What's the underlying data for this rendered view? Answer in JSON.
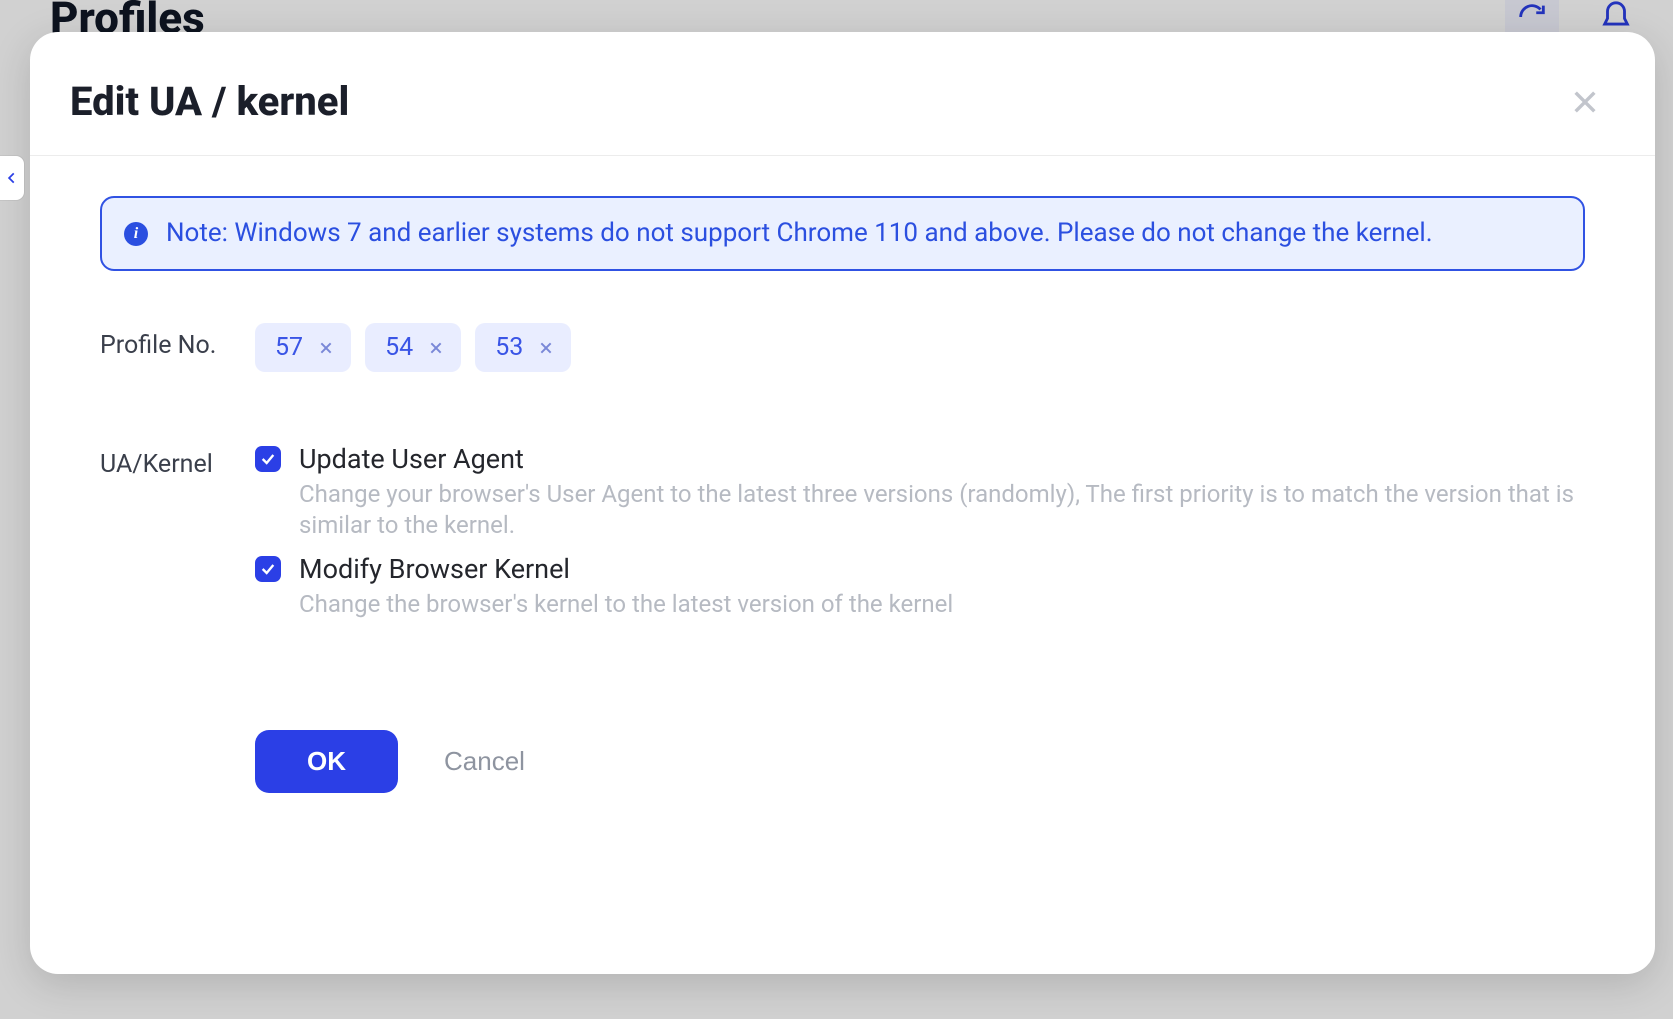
{
  "background": {
    "page_title": "Profiles"
  },
  "modal": {
    "title": "Edit UA / kernel",
    "alert": "Note: Windows 7 and earlier systems do not support Chrome 110 and above. Please do not change the kernel.",
    "profile_label": "Profile No.",
    "profile_tags": [
      "57",
      "54",
      "53"
    ],
    "ua_label": "UA/Kernel",
    "options": [
      {
        "title": "Update User Agent",
        "desc": "Change your browser's User Agent to the latest three versions (randomly), The first priority is to match the version that is similar to the kernel.",
        "checked": true
      },
      {
        "title": "Modify Browser Kernel",
        "desc": "Change the browser's kernel to the latest version of the kernel",
        "checked": true
      }
    ],
    "ok_label": "OK",
    "cancel_label": "Cancel"
  }
}
